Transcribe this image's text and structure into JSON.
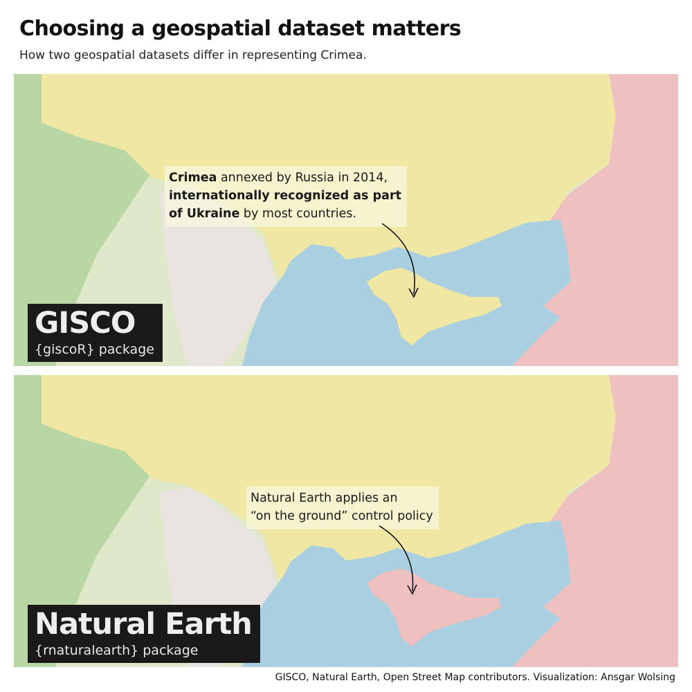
{
  "title": "Choosing a geospatial dataset matters",
  "subtitle": "How two geospatial datasets differ in representing Crimea.",
  "colors": {
    "ukraine": "#efe7a3",
    "russia": "#eec0c0",
    "sea": "#a9cfe0",
    "west_land": "#dfe8c9",
    "forest": "#b9d7a4",
    "moldova_romania": "#e9e4df",
    "label_bg": "#1a1a1a"
  },
  "panels": [
    {
      "dataset": "GISCO",
      "package": "{giscoR} package",
      "crimea_assigned_to": "ukraine",
      "annotation": {
        "lines": [
          [
            {
              "t": "Crimea",
              "b": true
            },
            {
              "t": " annexed by Russia in 2014,",
              "b": false
            }
          ],
          [
            {
              "t": "internationally recognized as part",
              "b": true
            }
          ],
          [
            {
              "t": "of Ukraine",
              "b": true
            },
            {
              "t": " by most countries.",
              "b": false
            }
          ]
        ]
      }
    },
    {
      "dataset": "Natural Earth",
      "package": "{rnaturalearth} package",
      "crimea_assigned_to": "russia",
      "annotation": {
        "lines": [
          [
            {
              "t": "Natural Earth applies an",
              "b": false
            }
          ],
          [
            {
              "t": "“on the ground” control policy",
              "b": false
            }
          ]
        ]
      }
    }
  ],
  "caption": "GISCO, Natural Earth, Open Street Map contributors. Visualization: Ansgar Wolsing",
  "icons": {
    "arrow": "curved-arrow-icon"
  }
}
